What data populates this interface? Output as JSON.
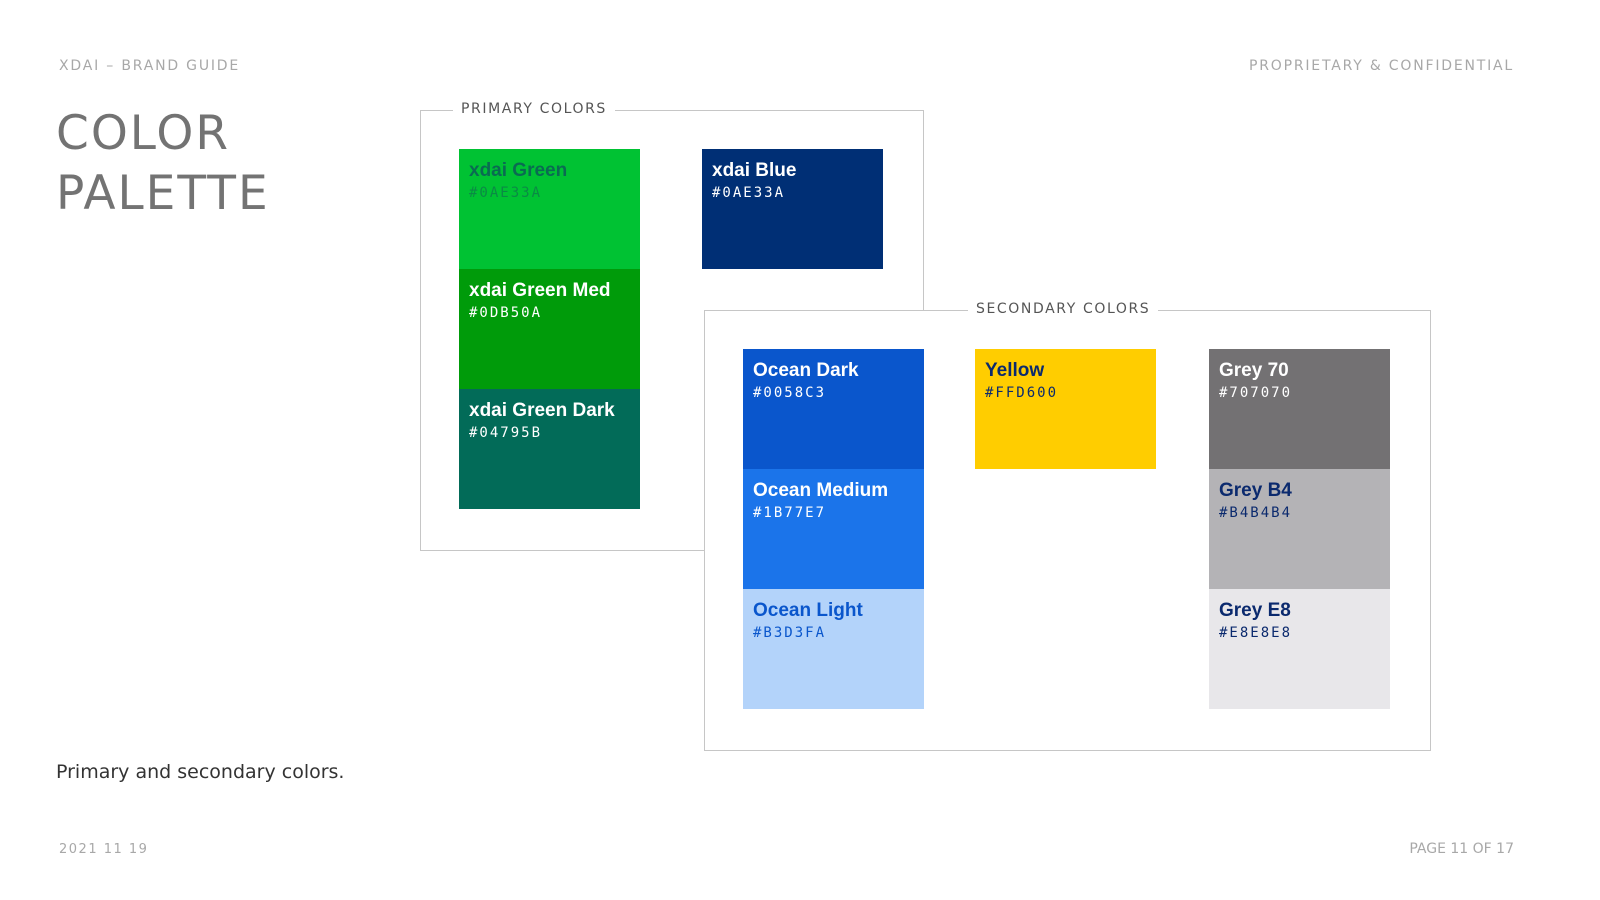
{
  "header": {
    "left": "XDAI – BRAND GUIDE",
    "right": "PROPRIETARY & CONFIDENTIAL"
  },
  "title": {
    "line1": "COLOR",
    "line2": "PALETTE"
  },
  "caption": "Primary and secondary colors.",
  "footer": {
    "date": "2021 11 19",
    "page": "PAGE 11 OF 17"
  },
  "primary": {
    "label": "PRIMARY COLORS",
    "green": [
      {
        "name": "xdai Green",
        "hex": "#0AE33A",
        "fill": "#00c233",
        "name_color": "#0a6b52",
        "hex_color": "#0a8a45"
      },
      {
        "name": "xdai Green Med",
        "hex": "#0DB50A",
        "fill": "#009b0a",
        "name_color": "#ffffff",
        "hex_color": "#ffffff"
      },
      {
        "name": "xdai Green Dark",
        "hex": "#04795B",
        "fill": "#026b58",
        "name_color": "#ffffff",
        "hex_color": "#ffffff"
      }
    ],
    "blue": [
      {
        "name": "xdai Blue",
        "hex": "#0AE33A",
        "fill": "#002f75",
        "name_color": "#ffffff",
        "hex_color": "#ffffff"
      }
    ]
  },
  "secondary": {
    "label": "SECONDARY COLORS",
    "ocean": [
      {
        "name": "Ocean Dark",
        "hex": "#0058C3",
        "fill": "#0a56cc",
        "name_color": "#ffffff",
        "hex_color": "#ffffff"
      },
      {
        "name": "Ocean Medium",
        "hex": "#1B77E7",
        "fill": "#1b74ea",
        "name_color": "#ffffff",
        "hex_color": "#ffffff"
      },
      {
        "name": "Ocean Light",
        "hex": "#B3D3FA",
        "fill": "#b3d3fa",
        "name_color": "#0a56cc",
        "hex_color": "#0a56cc"
      }
    ],
    "yellow": [
      {
        "name": "Yellow",
        "hex": "#FFD600",
        "fill": "#ffcd00",
        "name_color": "#0b2a6e",
        "hex_color": "#0b2a6e"
      }
    ],
    "grey": [
      {
        "name": "Grey 70",
        "hex": "#707070",
        "fill": "#737173",
        "name_color": "#ffffff",
        "hex_color": "#ffffff"
      },
      {
        "name": "Grey B4",
        "hex": "#B4B4B4",
        "fill": "#b4b3b6",
        "name_color": "#0b2a6e",
        "hex_color": "#0b2a6e"
      },
      {
        "name": "Grey E8",
        "hex": "#E8E8E8",
        "fill": "#e8e7ea",
        "name_color": "#0b2a6e",
        "hex_color": "#0b2a6e"
      }
    ]
  }
}
